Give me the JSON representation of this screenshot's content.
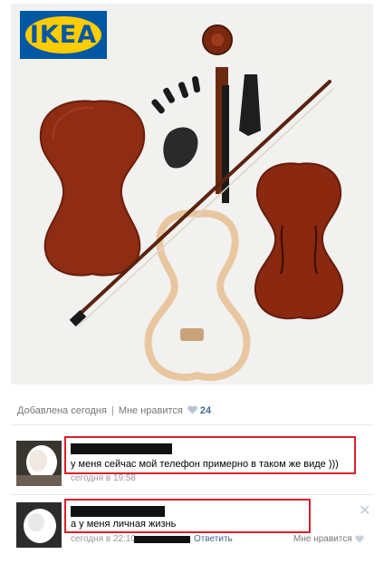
{
  "brand": {
    "logo_text": "IKEA",
    "blue": "#0057a3",
    "yellow": "#ffcc00"
  },
  "post": {
    "image_subject": "violin-parts-illustration",
    "added_label": "Добавлена сегодня",
    "like_label": "Мне нравится",
    "like_count": "24"
  },
  "comments": [
    {
      "text": "у меня сейчас мой телефон примерно в таком же виде )))",
      "date": "сегодня в 19:58"
    },
    {
      "text": "а у меня личная жизнь",
      "date": "сегодня в 22:10",
      "reply_label": "Ответить",
      "like_label": "Мне нравится",
      "close_icon": "close-icon"
    }
  ],
  "colors": {
    "link": "#45688e",
    "highlight": "#d9202a",
    "muted": "#999999"
  }
}
